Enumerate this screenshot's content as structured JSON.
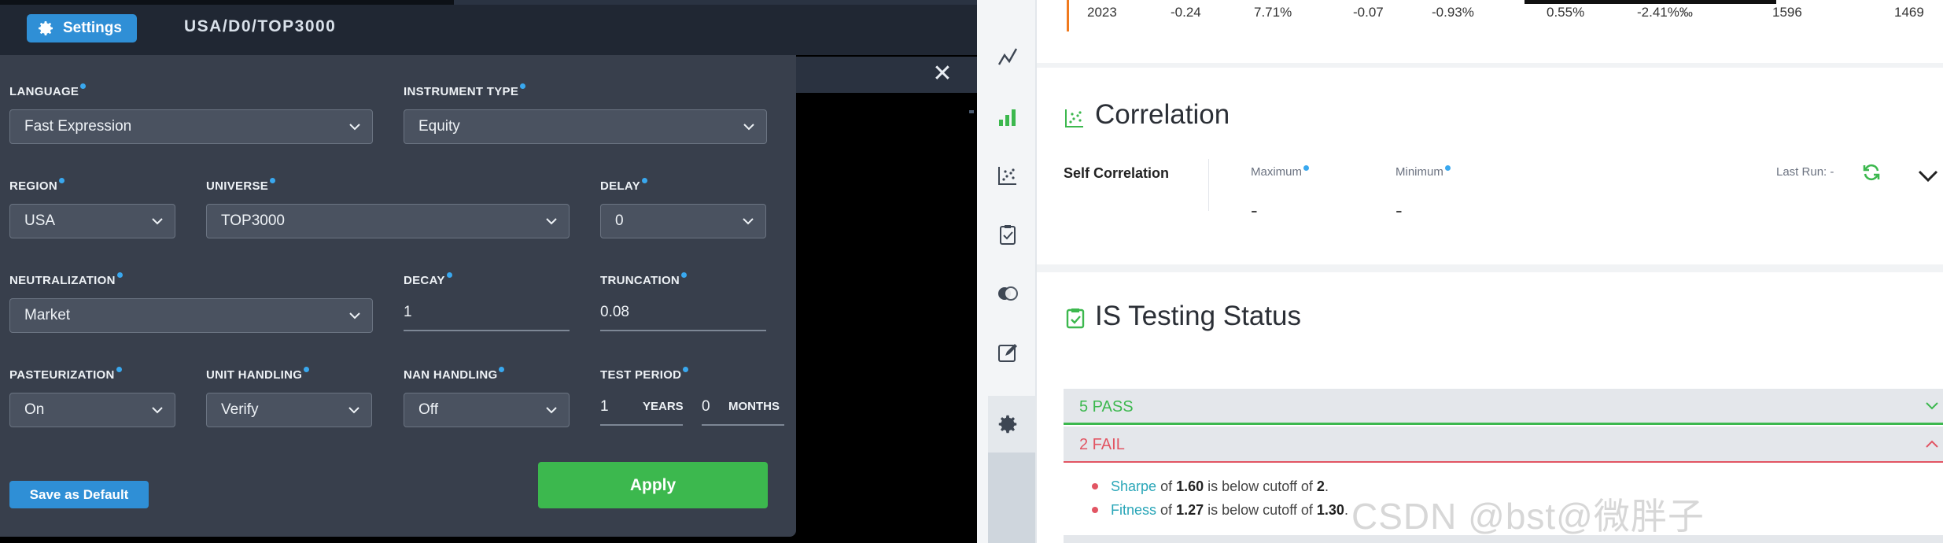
{
  "header": {
    "settings_label": "Settings",
    "sim_path": "USA/D0/TOP3000"
  },
  "settings": {
    "language": {
      "label": "LANGUAGE",
      "value": "Fast Expression"
    },
    "instrument_type": {
      "label": "INSTRUMENT TYPE",
      "value": "Equity"
    },
    "region": {
      "label": "REGION",
      "value": "USA"
    },
    "universe": {
      "label": "UNIVERSE",
      "value": "TOP3000"
    },
    "delay": {
      "label": "DELAY",
      "value": "0"
    },
    "neutralization": {
      "label": "NEUTRALIZATION",
      "value": "Market"
    },
    "decay": {
      "label": "DECAY",
      "value": "1"
    },
    "truncation": {
      "label": "TRUNCATION",
      "value": "0.08"
    },
    "pasteurization": {
      "label": "PASTEURIZATION",
      "value": "On"
    },
    "unit_handling": {
      "label": "UNIT HANDLING",
      "value": "Verify"
    },
    "nan_handling": {
      "label": "NAN HANDLING",
      "value": "Off"
    },
    "test_period": {
      "label": "TEST PERIOD",
      "years_value": "1",
      "years_unit": "YEARS",
      "months_value": "0",
      "months_unit": "MONTHS"
    },
    "save_default_label": "Save as Default",
    "apply_label": "Apply"
  },
  "yearly_row": {
    "year": "2023",
    "cells": [
      "-0.24",
      "7.71%",
      "-0.07",
      "-0.93%",
      "0.55%",
      "-2.41%‰",
      "1596",
      "1469"
    ]
  },
  "correlation": {
    "title": "Correlation",
    "self_label": "Self Correlation",
    "maximum_label": "Maximum",
    "maximum_value": "-",
    "minimum_label": "Minimum",
    "minimum_value": "-",
    "last_run": "Last Run: -"
  },
  "is_testing": {
    "title": "IS Testing Status",
    "pass_label": "5 PASS",
    "fail_label": "2 FAIL",
    "failures": [
      {
        "metric": "Sharpe",
        "of": "of",
        "value": "1.60",
        "text": "is below cutoff of",
        "cutoff": "2",
        "end": "."
      },
      {
        "metric": "Fitness",
        "of": "of",
        "value": "1.27",
        "text": "is below cutoff of",
        "cutoff": "1.30",
        "end": "."
      }
    ]
  },
  "watermark": "CSDN @bst@微胖子",
  "colors": {
    "accent_blue": "#2f8fd6",
    "apply_green": "#3cb84e",
    "fail_red": "#e25563",
    "panel_bg": "#383f4c"
  },
  "icons": [
    "gear-icon",
    "chevron-down-icon",
    "close-icon",
    "line-chart-icon",
    "bar-chart-icon",
    "scatter-icon",
    "clipboard-check-icon",
    "toggle-icon",
    "edit-icon",
    "refresh-icon"
  ]
}
